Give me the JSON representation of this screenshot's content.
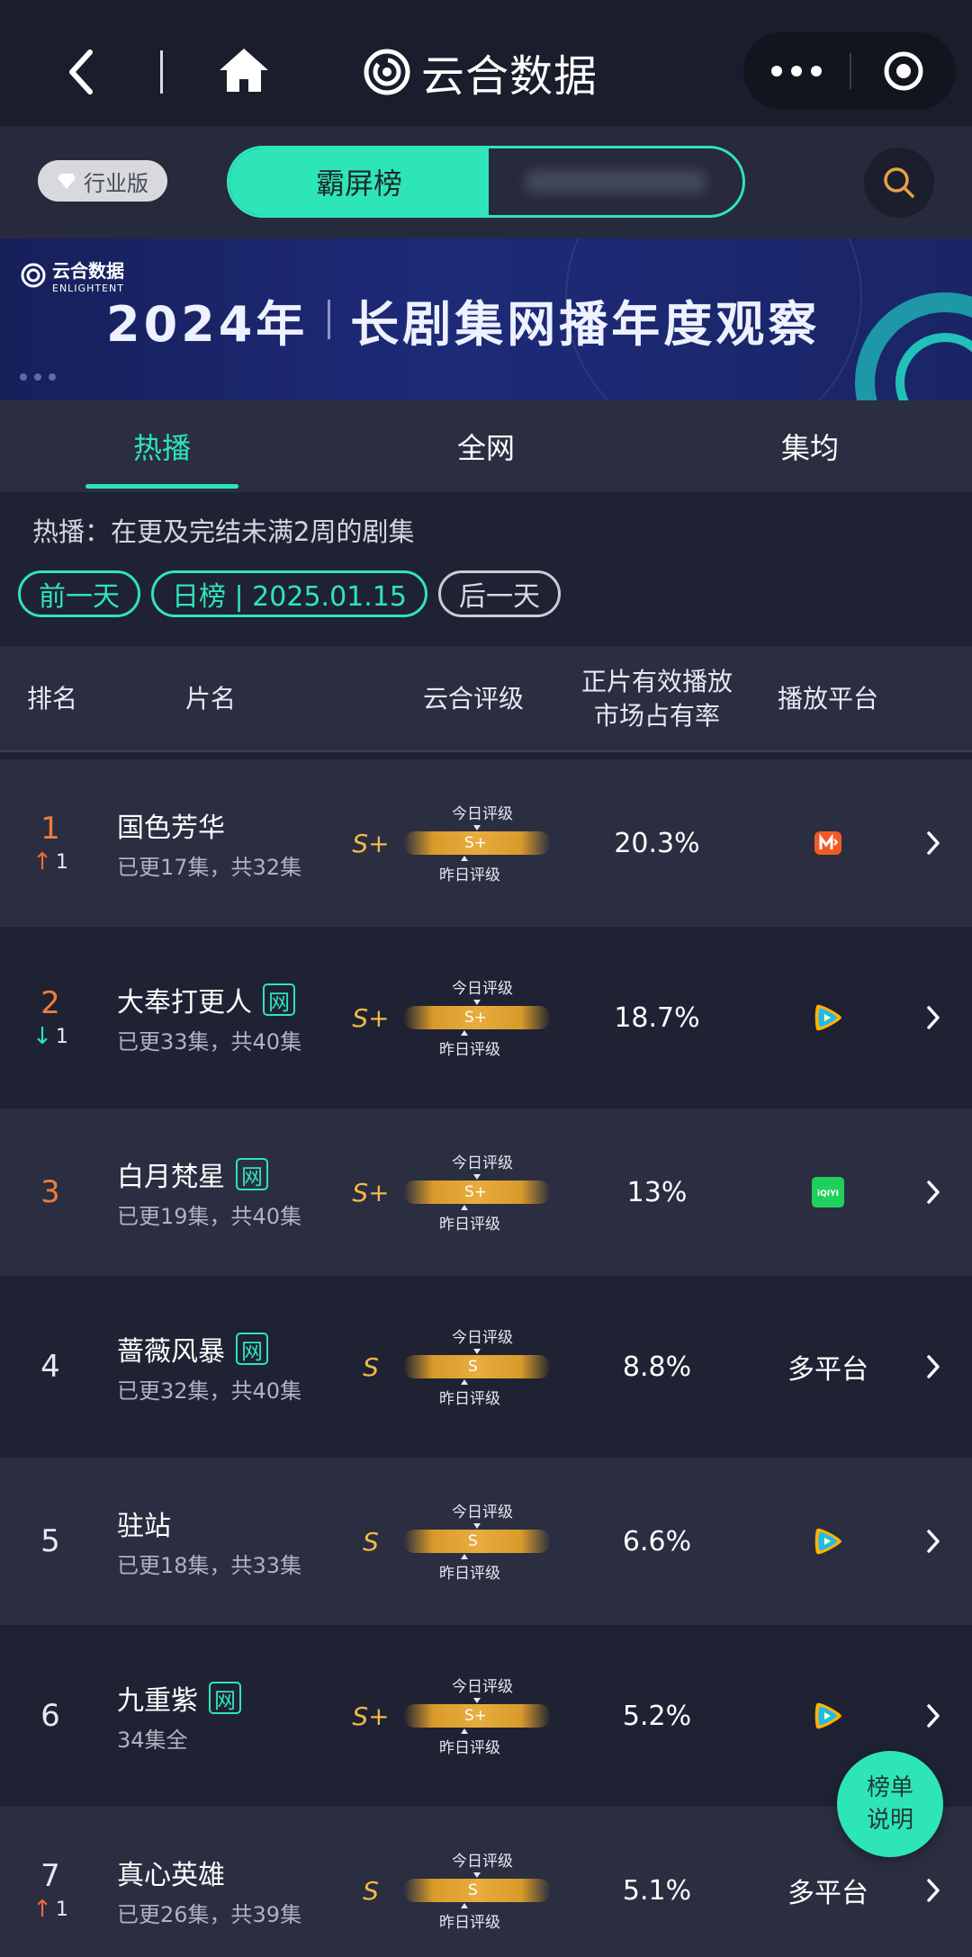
{
  "nav": {
    "brand_name": "云合数据"
  },
  "subbar": {
    "edition_label": "行业版",
    "toggle_active": "霸屏榜"
  },
  "banner": {
    "logo_name": "云合数据",
    "logo_sub": "ENLIGHTENT",
    "year": "2024年",
    "title": "长剧集网播年度观察"
  },
  "tabs": [
    "热播",
    "全网",
    "集均"
  ],
  "description": "热播：在更及完结未满2周的剧集",
  "datebar": {
    "prev": "前一天",
    "current": "日榜 | 2025.01.15",
    "next": "后一天"
  },
  "table": {
    "headers": {
      "rank": "排名",
      "name": "片名",
      "grade": "云合评级",
      "share_line1": "正片有效播放",
      "share_line2": "市场占有率",
      "platform": "播放平台"
    },
    "meter_today": "今日评级",
    "meter_yesterday": "昨日评级",
    "rows": [
      {
        "rank": "1",
        "change": "1",
        "title": "国色芳华",
        "net": "",
        "episodes": "已更17集，共32集",
        "grade": "S+",
        "meter": "S+",
        "share": "20.3%",
        "platform": ""
      },
      {
        "rank": "2",
        "change": "1",
        "title": "大奉打更人",
        "net": "网",
        "episodes": "已更33集，共40集",
        "grade": "S+",
        "meter": "S+",
        "share": "18.7%",
        "platform": ""
      },
      {
        "rank": "3",
        "change": "",
        "title": "白月梵星",
        "net": "网",
        "episodes": "已更19集，共40集",
        "grade": "S+",
        "meter": "S+",
        "share": "13%",
        "platform": ""
      },
      {
        "rank": "4",
        "change": "",
        "title": "蔷薇风暴",
        "net": "网",
        "episodes": "已更32集，共40集",
        "grade": "S",
        "meter": "S",
        "share": "8.8%",
        "platform": "多平台"
      },
      {
        "rank": "5",
        "change": "",
        "title": "驻站",
        "net": "",
        "episodes": "已更18集，共33集",
        "grade": "S",
        "meter": "S",
        "share": "6.6%",
        "platform": ""
      },
      {
        "rank": "6",
        "change": "",
        "title": "九重紫",
        "net": "网",
        "episodes": "34集全",
        "grade": "S+",
        "meter": "S+",
        "share": "5.2%",
        "platform": ""
      },
      {
        "rank": "7",
        "change": "1",
        "title": "真心英雄",
        "net": "",
        "episodes": "已更26集，共39集",
        "grade": "S",
        "meter": "S",
        "share": "5.1%",
        "platform": "多平台"
      }
    ]
  },
  "float_button": {
    "line1": "榜单",
    "line2": "说明"
  },
  "colors": {
    "accent": "#2ee5b8",
    "gold": "#f2b84b",
    "up": "#ef6b3a"
  },
  "platform_icons": [
    "mango-tv-icon",
    "tencent-video-icon",
    "iqiyi-icon",
    "tencent-video-icon",
    "tencent-video-icon"
  ]
}
